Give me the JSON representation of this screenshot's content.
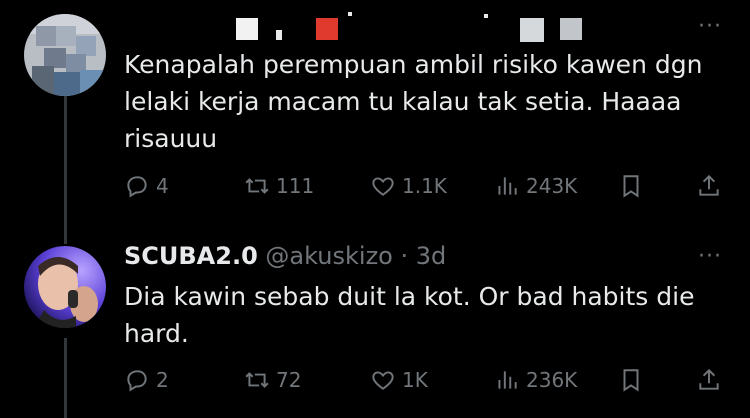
{
  "tweets": [
    {
      "display_name": "",
      "handle": "",
      "time": "",
      "text": "Kenapalah perempuan ambil risiko kawen dgn lelaki kerja macam tu kalau tak setia. Haaaa risauuu",
      "more": "···",
      "replies": "4",
      "retweets": "111",
      "likes": "1.1K",
      "views": "243K"
    },
    {
      "display_name": "SCUBA2.0",
      "handle": "@akuskizo",
      "time": "· 3d",
      "text": "Dia kawin sebab duit la kot. Or bad habits die hard.",
      "more": "···",
      "replies": "2",
      "retweets": "72",
      "likes": "1K",
      "views": "236K"
    }
  ],
  "colors": {
    "background": "#000000",
    "text": "#e7e9ea",
    "muted": "#71767b",
    "thread_line": "#333639"
  },
  "icons": [
    "reply-icon",
    "retweet-icon",
    "like-icon",
    "views-icon",
    "bookmark-icon",
    "share-icon"
  ]
}
